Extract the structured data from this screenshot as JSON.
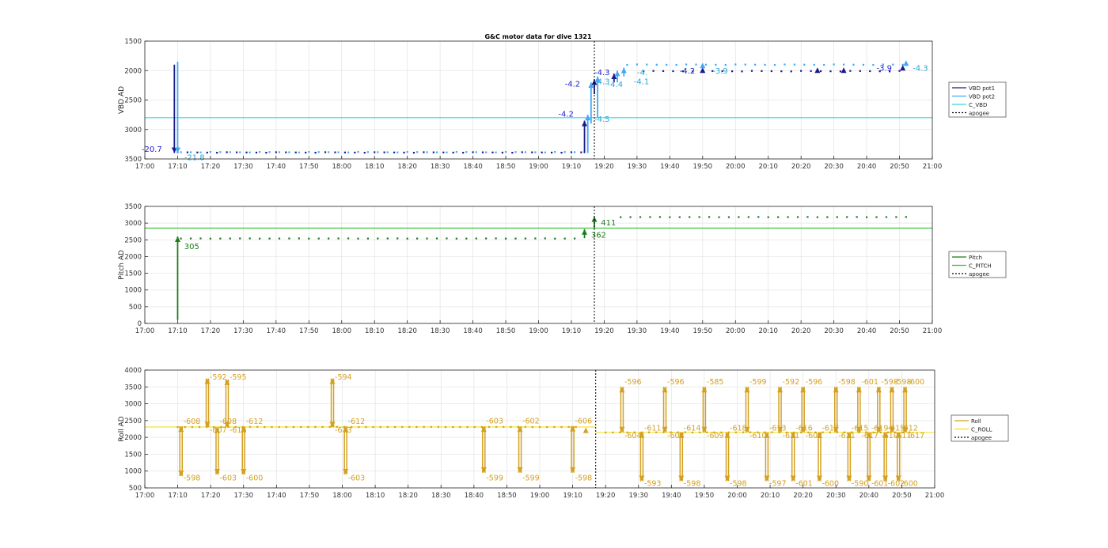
{
  "figure": {
    "title": "G&C motor data for dive 1321",
    "x_ticks": [
      "17:00",
      "17:10",
      "17:20",
      "17:30",
      "17:40",
      "17:50",
      "18:00",
      "18:10",
      "18:20",
      "18:30",
      "18:40",
      "18:50",
      "19:00",
      "19:10",
      "19:20",
      "19:30",
      "19:40",
      "19:50",
      "20:00",
      "20:10",
      "20:20",
      "20:30",
      "20:40",
      "20:50",
      "21:00"
    ]
  },
  "colors": {
    "vbd_pot1": "#1a1a8c",
    "vbd_pot2": "#3fa9f5",
    "c_vbd": "#33d6e0",
    "vbd_label_dark": "#1e1ecc",
    "vbd_label_light": "#2aa8d8",
    "pitch": "#1e7b1e",
    "c_pitch": "#2fbf2f",
    "roll": "#d4a020",
    "c_roll": "#f0e020",
    "apogee": "#000000",
    "grid": "#e3e3e3",
    "axes": "#262626"
  },
  "chart_data": [
    {
      "type": "line",
      "name": "vbd",
      "ylabel": "VBD AD",
      "y_reversed": true,
      "ylim": [
        1500,
        3500
      ],
      "y_ticks": [
        "1500",
        "2000",
        "2500",
        "3000",
        "3500"
      ],
      "xlim": [
        "17:00",
        "21:00"
      ],
      "grid": true,
      "legend": {
        "placement": "right",
        "entries": [
          "VBD pot1",
          "VBD pot2",
          "C_VBD",
          "apogee"
        ]
      },
      "c_value": 2800,
      "apogee_x": "19:17",
      "series": [
        {
          "name": "VBD pot1",
          "color_key": "vbd_pot1",
          "baseline_samples": {
            "from": "17:10",
            "to": "19:15",
            "value": 3390
          },
          "post_samples": {
            "from": "19:32",
            "to": "20:52",
            "value": 2010
          }
        },
        {
          "name": "VBD pot2",
          "color_key": "vbd_pot2",
          "baseline_samples": {
            "from": "17:11",
            "to": "19:15",
            "value": 3385
          },
          "post_samples": {
            "from": "19:27",
            "to": "20:53",
            "value": 1900
          }
        }
      ],
      "moves": [
        {
          "x": "17:09",
          "from": 1900,
          "to": 3400,
          "color_key": "vbd_pot1"
        },
        {
          "x": "17:10",
          "from": 1850,
          "to": 3400,
          "color_key": "vbd_pot2"
        },
        {
          "x": "19:14",
          "from": 3400,
          "to": 2850,
          "color_key": "vbd_pot1"
        },
        {
          "x": "19:15",
          "from": 3400,
          "to": 2750,
          "color_key": "vbd_pot2"
        },
        {
          "x": "19:16",
          "from": 2900,
          "to": 2200,
          "color_key": "vbd_pot2"
        },
        {
          "x": "19:17",
          "from": 2400,
          "to": 2150,
          "color_key": "vbd_pot1"
        },
        {
          "x": "19:18",
          "from": 2800,
          "to": 2100,
          "color_key": "vbd_pot2"
        },
        {
          "x": "19:23",
          "from": 2200,
          "to": 2050,
          "color_key": "vbd_pot1"
        },
        {
          "x": "19:24",
          "from": 2200,
          "to": 2000,
          "color_key": "vbd_pot2"
        },
        {
          "x": "19:26",
          "from": 2100,
          "to": 1950,
          "color_key": "vbd_pot2"
        }
      ],
      "markers": [
        {
          "x": "19:50",
          "y": 2000,
          "color_key": "vbd_pot1"
        },
        {
          "x": "19:50",
          "y": 1920,
          "color_key": "vbd_pot2"
        },
        {
          "x": "20:25",
          "y": 2000,
          "color_key": "vbd_pot1"
        },
        {
          "x": "20:33",
          "y": 2000,
          "color_key": "vbd_pot1"
        },
        {
          "x": "20:51",
          "y": 1960,
          "color_key": "vbd_pot1"
        },
        {
          "x": "20:52",
          "y": 1880,
          "color_key": "vbd_pot2"
        }
      ],
      "annotations": [
        {
          "text": "-20.7",
          "x": "16:59",
          "y": 3380,
          "color_key": "vbd_label_dark"
        },
        {
          "text": "-21.8",
          "x": "17:12",
          "y": 3520,
          "color_key": "vbd_label_light"
        },
        {
          "text": "-4.2",
          "x": "19:06",
          "y": 2780,
          "color_key": "vbd_label_dark"
        },
        {
          "text": "-4.5",
          "x": "19:17",
          "y": 2870,
          "color_key": "vbd_label_light"
        },
        {
          "text": "-4.2",
          "x": "19:08",
          "y": 2270,
          "color_key": "vbd_label_dark"
        },
        {
          "text": "-4.3",
          "x": "19:17",
          "y": 2080,
          "color_key": "vbd_label_dark"
        },
        {
          "text": "-4.3",
          "x": "19:17",
          "y": 2230,
          "color_key": "vbd_label_light"
        },
        {
          "text": "-4.4",
          "x": "19:21",
          "y": 2280,
          "color_key": "vbd_label_light"
        },
        {
          "text": "-4.1",
          "x": "19:29",
          "y": 2230,
          "color_key": "vbd_label_light"
        },
        {
          "text": "-4.",
          "x": "19:30",
          "y": 2080,
          "color_key": "vbd_label_light"
        },
        {
          "text": "-4.2",
          "x": "19:43",
          "y": 2050,
          "color_key": "vbd_label_dark"
        },
        {
          "text": "-3.9",
          "x": "19:53",
          "y": 2050,
          "color_key": "vbd_label_light"
        },
        {
          "text": "-3.9",
          "x": "20:43",
          "y": 2000,
          "color_key": "vbd_label_dark"
        },
        {
          "text": "-4.3",
          "x": "20:54",
          "y": 2000,
          "color_key": "vbd_label_light"
        }
      ]
    },
    {
      "type": "line",
      "name": "pitch",
      "ylabel": "Pitch AD",
      "y_reversed": false,
      "ylim": [
        0,
        3500
      ],
      "y_ticks": [
        "0",
        "500",
        "1000",
        "1500",
        "2000",
        "2500",
        "3000",
        "3500"
      ],
      "xlim": [
        "17:00",
        "21:00"
      ],
      "grid": true,
      "legend": {
        "placement": "right",
        "entries": [
          "Pitch",
          "C_PITCH",
          "apogee"
        ]
      },
      "c_value": 2850,
      "apogee_x": "19:17",
      "series": [
        {
          "name": "Pitch",
          "color_key": "pitch",
          "baseline_samples": {
            "from": "17:11",
            "to": "19:11",
            "value": 2540
          },
          "post_samples": {
            "from": "19:25",
            "to": "20:53",
            "value": 3180
          }
        }
      ],
      "moves": [
        {
          "x": "17:10",
          "from": 100,
          "to": 2600,
          "color_key": "pitch"
        },
        {
          "x": "19:14",
          "from": 2550,
          "to": 2820,
          "color_key": "pitch"
        },
        {
          "x": "19:17",
          "from": 2850,
          "to": 3200,
          "color_key": "pitch"
        }
      ],
      "markers": [],
      "annotations": [
        {
          "text": "305",
          "x": "17:12",
          "y": 2220,
          "color_key": "pitch"
        },
        {
          "text": "411",
          "x": "19:19",
          "y": 2930,
          "color_key": "pitch"
        },
        {
          "text": "362",
          "x": "19:16",
          "y": 2560,
          "color_key": "pitch"
        }
      ]
    },
    {
      "type": "line",
      "name": "roll",
      "ylabel": "Roll AD",
      "y_reversed": false,
      "ylim": [
        500,
        4000
      ],
      "y_ticks": [
        "500",
        "1000",
        "1500",
        "2000",
        "2500",
        "3000",
        "3500",
        "4000"
      ],
      "xlim": [
        "17:00",
        "21:00"
      ],
      "grid": true,
      "legend": {
        "placement": "right",
        "entries": [
          "Roll",
          "C_ROLL",
          "apogee"
        ]
      },
      "c_value_segments": [
        {
          "from": "17:00",
          "to": "19:17",
          "value": 2310
        },
        {
          "from": "19:17",
          "to": "21:00",
          "value": 2150
        }
      ],
      "apogee_x": "19:17",
      "series": [
        {
          "name": "Roll",
          "color_key": "roll",
          "baseline_samples": {
            "from": "17:10",
            "to": "19:12",
            "value": 2310
          },
          "post_samples": {
            "from": "19:20",
            "to": "20:53",
            "value": 2150
          }
        }
      ],
      "swings": [
        {
          "x": "17:11",
          "up_to": 2330,
          "down_to": 850,
          "up_label": "-608",
          "down_label": "-598",
          "up_label_y": 2400,
          "down_label_y": 720
        },
        {
          "x": "17:19",
          "up_to": 3750,
          "down_to": 2300,
          "up_label": "-592",
          "down_label": "-607",
          "up_label_y": 3720,
          "down_label_y": 2150
        },
        {
          "x": "17:22",
          "up_to": 2300,
          "down_to": 900,
          "up_label": "-608",
          "down_label": "-603",
          "up_label_y": 2400,
          "down_label_y": 720
        },
        {
          "x": "17:25",
          "up_to": 3720,
          "down_to": 2300,
          "up_label": "-595",
          "down_label": "-616",
          "up_label_y": 3720,
          "down_label_y": 2150
        },
        {
          "x": "17:30",
          "up_to": 2320,
          "down_to": 900,
          "up_label": "-612",
          "down_label": "-600",
          "up_label_y": 2400,
          "down_label_y": 720
        },
        {
          "x": "17:57",
          "up_to": 3750,
          "down_to": 2300,
          "up_label": "-594",
          "down_label": "-613",
          "up_label_y": 3720,
          "down_label_y": 2150
        },
        {
          "x": "18:01",
          "up_to": 2330,
          "down_to": 900,
          "up_label": "-612",
          "down_label": "-603",
          "up_label_y": 2400,
          "down_label_y": 720
        },
        {
          "x": "18:43",
          "up_to": 2330,
          "down_to": 950,
          "up_label": "-603",
          "down_label": "-599",
          "up_label_y": 2420,
          "down_label_y": 720
        },
        {
          "x": "18:54",
          "up_to": 2330,
          "down_to": 950,
          "up_label": "-602",
          "down_label": "-599",
          "up_label_y": 2420,
          "down_label_y": 720
        },
        {
          "x": "19:10",
          "up_to": 2340,
          "down_to": 950,
          "up_label": "-606",
          "down_label": "-598",
          "up_label_y": 2420,
          "down_label_y": 720
        },
        {
          "x": "19:25",
          "up_to": 3500,
          "down_to": 2150,
          "up_label": "-596",
          "down_label": "-604",
          "up_label_y": 3580,
          "down_label_y": 1980
        },
        {
          "x": "19:31",
          "up_to": 2150,
          "down_to": 700,
          "up_label": "-611",
          "down_label": "-593",
          "up_label_y": 2200,
          "down_label_y": 560
        },
        {
          "x": "19:38",
          "up_to": 3500,
          "down_to": 2150,
          "up_label": "-596",
          "down_label": "-608",
          "up_label_y": 3580,
          "down_label_y": 1980
        },
        {
          "x": "19:43",
          "up_to": 2150,
          "down_to": 700,
          "up_label": "-614",
          "down_label": "-598",
          "up_label_y": 2200,
          "down_label_y": 560
        },
        {
          "x": "19:50",
          "up_to": 3500,
          "down_to": 2150,
          "up_label": "-585",
          "down_label": "-609",
          "up_label_y": 3580,
          "down_label_y": 1980
        },
        {
          "x": "19:57",
          "up_to": 2150,
          "down_to": 700,
          "up_label": "-618",
          "down_label": "-598",
          "up_label_y": 2200,
          "down_label_y": 560
        },
        {
          "x": "20:03",
          "up_to": 3500,
          "down_to": 2150,
          "up_label": "-599",
          "down_label": "-610",
          "up_label_y": 3580,
          "down_label_y": 1980
        },
        {
          "x": "20:09",
          "up_to": 2150,
          "down_to": 700,
          "up_label": "-613",
          "down_label": "-597",
          "up_label_y": 2200,
          "down_label_y": 560
        },
        {
          "x": "20:13",
          "up_to": 3500,
          "down_to": 2150,
          "up_label": "-592",
          "down_label": "-611",
          "up_label_y": 3580,
          "down_label_y": 1980
        },
        {
          "x": "20:17",
          "up_to": 2150,
          "down_to": 700,
          "up_label": "-616",
          "down_label": "-601",
          "up_label_y": 2200,
          "down_label_y": 560
        },
        {
          "x": "20:20",
          "up_to": 3500,
          "down_to": 2150,
          "up_label": "-596",
          "down_label": "-602",
          "up_label_y": 3580,
          "down_label_y": 1980
        },
        {
          "x": "20:25",
          "up_to": 2150,
          "down_to": 700,
          "up_label": "-617",
          "down_label": "-600",
          "up_label_y": 2200,
          "down_label_y": 560
        },
        {
          "x": "20:30",
          "up_to": 3500,
          "down_to": 2150,
          "up_label": "-598",
          "down_label": "-611",
          "up_label_y": 3580,
          "down_label_y": 1980
        },
        {
          "x": "20:34",
          "up_to": 2150,
          "down_to": 700,
          "up_label": "-615",
          "down_label": "-590",
          "up_label_y": 2200,
          "down_label_y": 560
        },
        {
          "x": "20:37",
          "up_to": 3500,
          "down_to": 2150,
          "up_label": "-601",
          "down_label": "-617",
          "up_label_y": 3580,
          "down_label_y": 1980
        },
        {
          "x": "20:40",
          "up_to": 2150,
          "down_to": 700,
          "up_label": "-619",
          "down_label": "-601",
          "up_label_y": 2200,
          "down_label_y": 560
        },
        {
          "x": "20:43",
          "up_to": 3500,
          "down_to": 2150,
          "up_label": "-598",
          "down_label": "-610",
          "up_label_y": 3580,
          "down_label_y": 1980
        },
        {
          "x": "20:45",
          "up_to": 2150,
          "down_to": 700,
          "up_label": "-615",
          "down_label": "-602",
          "up_label_y": 2200,
          "down_label_y": 560
        },
        {
          "x": "20:47",
          "up_to": 3500,
          "down_to": 2150,
          "up_label": "-598",
          "down_label": "-611",
          "up_label_y": 3580,
          "down_label_y": 1980
        },
        {
          "x": "20:49",
          "up_to": 2150,
          "down_to": 700,
          "up_label": "-612",
          "down_label": "-600",
          "up_label_y": 2200,
          "down_label_y": 560
        },
        {
          "x": "20:51",
          "up_to": 3500,
          "down_to": 2150,
          "up_label": "-600",
          "down_label": "-617",
          "up_label_y": 3580,
          "down_label_y": 1980
        }
      ],
      "markers": [
        {
          "x": "19:14",
          "y": 2200,
          "color_key": "roll"
        }
      ]
    }
  ]
}
